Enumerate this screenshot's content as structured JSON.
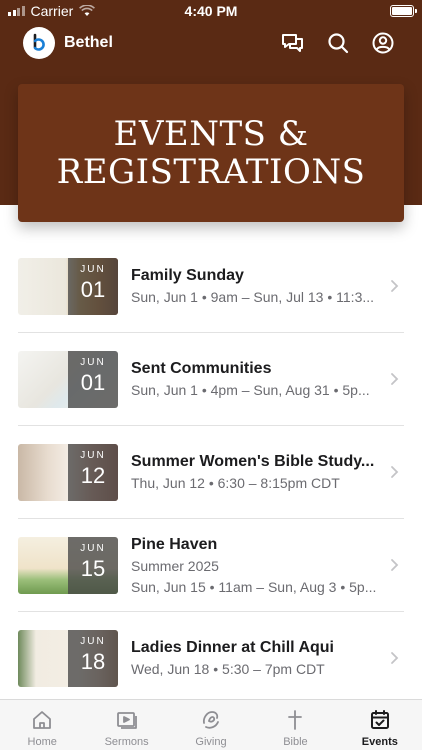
{
  "status_bar": {
    "carrier": "Carrier",
    "time": "4:40 PM"
  },
  "app": {
    "name": "Bethel"
  },
  "colors": {
    "header_brown": "#5a2a14",
    "hero_brown": "#6e3418",
    "accent_blue": "#1a7fd6"
  },
  "header_icons": [
    "chat-icon",
    "search-icon",
    "profile-icon"
  ],
  "hero": {
    "title": "EVENTS &\nREGISTRATIONS"
  },
  "events": [
    {
      "month": "JUN",
      "day": "01",
      "title": "Family Sunday",
      "lines": [
        "Sun, Jun 1 • 9am – Sun, Jul 13 • 11:3..."
      ]
    },
    {
      "month": "JUN",
      "day": "01",
      "title": "Sent Communities",
      "lines": [
        "Sun, Jun 1 • 4pm – Sun, Aug 31 • 5p..."
      ]
    },
    {
      "month": "JUN",
      "day": "12",
      "title": "Summer Women's Bible Study...",
      "lines": [
        "Thu, Jun 12 • 6:30 – 8:15pm CDT"
      ]
    },
    {
      "month": "JUN",
      "day": "15",
      "title": "Pine Haven",
      "lines": [
        "Summer 2025",
        "Sun, Jun 15 • 11am – Sun, Aug 3 • 5p..."
      ]
    },
    {
      "month": "JUN",
      "day": "18",
      "title": "Ladies Dinner at Chill Aqui",
      "lines": [
        "Wed, Jun 18 • 5:30 – 7pm CDT"
      ]
    }
  ],
  "tabs": [
    {
      "label": "Home",
      "icon": "home-icon",
      "active": false
    },
    {
      "label": "Sermons",
      "icon": "sermons-icon",
      "active": false
    },
    {
      "label": "Giving",
      "icon": "giving-icon",
      "active": false
    },
    {
      "label": "Bible",
      "icon": "bible-icon",
      "active": false
    },
    {
      "label": "Events",
      "icon": "events-icon",
      "active": true
    }
  ]
}
